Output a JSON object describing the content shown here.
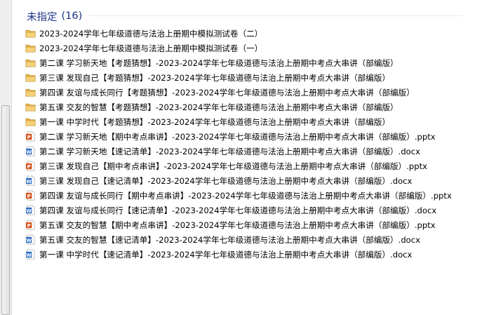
{
  "group": {
    "title": "未指定",
    "count": "(16)"
  },
  "items": [
    {
      "type": "folder",
      "name": "2023-2024学年七年级道德与法治上册期中模拟测试卷（二）",
      "icon": "folder-icon"
    },
    {
      "type": "folder",
      "name": "2023-2024学年七年级道德与法治上册期中模拟测试卷（一）",
      "icon": "folder-icon"
    },
    {
      "type": "folder",
      "name": "第二课 学习新天地【考题猜想】-2023-2024学年七年级道德与法治上册期中考点大串讲（部编版）",
      "icon": "folder-icon"
    },
    {
      "type": "folder",
      "name": "第三课 发现自己【考题猜想】-2023-2024学年七年级道德与法治上册期中考点大串讲（部编版）",
      "icon": "folder-icon"
    },
    {
      "type": "folder",
      "name": "第四课 友谊与成长同行【考题猜想】-2023-2024学年七年级道德与法治上册期中考点大串讲（部编版）",
      "icon": "folder-icon"
    },
    {
      "type": "folder",
      "name": "第五课 交友的智慧【考题猜想】-2023-2024学年七年级道德与法治上册期中考点大串讲（部编版）",
      "icon": "folder-icon"
    },
    {
      "type": "folder",
      "name": "第一课 中学时代【考题猜想】-2023-2024学年七年级道德与法治上册期中考点大串讲（部编版）",
      "icon": "folder-icon"
    },
    {
      "type": "pptx",
      "name": "第二课 学习新天地【期中考点串讲】-2023-2024学年七年级道德与法治上册期中考点大串讲（部编版）.pptx",
      "icon": "powerpoint-file-icon"
    },
    {
      "type": "docx",
      "name": "第二课 学习新天地【速记清单】-2023-2024学年七年级道德与法治上册期中考点大串讲（部编版）.docx",
      "icon": "word-file-icon"
    },
    {
      "type": "pptx",
      "name": "第三课 发现自己【期中考点串讲】-2023-2024学年七年级道德与法治上册期中考点大串讲（部编版）.pptx",
      "icon": "powerpoint-file-icon"
    },
    {
      "type": "docx",
      "name": "第三课 发现自己【速记清单】-2023-2024学年七年级道德与法治上册期中考点大串讲（部编版）.docx",
      "icon": "word-file-icon"
    },
    {
      "type": "pptx",
      "name": "第四课 友谊与成长同行【期中考点串讲】-2023-2024学年七年级道德与法治上册期中考点大串讲（部编版）.pptx",
      "icon": "powerpoint-file-icon"
    },
    {
      "type": "docx",
      "name": "第四课 友谊与成长同行【速记清单】-2023-2024学年七年级道德与法治上册期中考点大串讲（部编版）.docx",
      "icon": "word-file-icon"
    },
    {
      "type": "pptx",
      "name": "第五课 交友的智慧【期中考点串讲】-2023-2024学年七年级道德与法治上册期中考点大串讲（部编版）.pptx",
      "icon": "powerpoint-file-icon"
    },
    {
      "type": "docx",
      "name": "第五课 交友的智慧【速记清单】-2023-2024学年七年级道德与法治上册期中考点大串讲（部编版）.docx",
      "icon": "word-file-icon"
    },
    {
      "type": "docx",
      "name": "第一课 中学时代【速记清单】-2023-2024学年七年级道德与法治上册期中考点大串讲（部编版）.docx",
      "icon": "word-file-icon"
    }
  ],
  "colors": {
    "group_title": "#1e3287",
    "folder": "#e8b94a",
    "pptx": "#d9531e",
    "docx": "#2b6cc4"
  }
}
